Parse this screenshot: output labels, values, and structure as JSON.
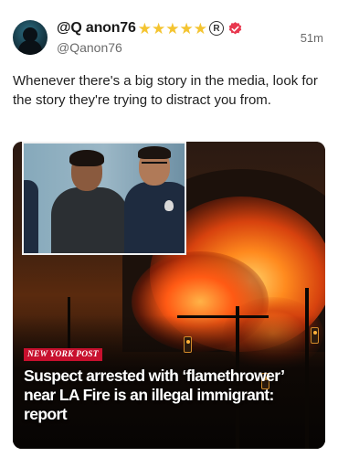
{
  "author": {
    "display_name": "@Q anon76",
    "handle": "@Qanon76",
    "stars": [
      "★",
      "★",
      "★",
      "★",
      "★"
    ],
    "registered_mark": "R",
    "avatar_icon": "avatar-silhouette-icon",
    "verified_icon": "verified-badge-icon",
    "accent_colors": {
      "star": "#f4c430",
      "verified": "#e8384f"
    }
  },
  "timestamp": "51m",
  "post": {
    "text": "Whenever there's a big story in the media, look for the story they're trying to distract you from."
  },
  "media": {
    "source_label": "NEW YORK POST",
    "headline": "Suspect arrested with ‘flamethrower’ near LA Fire is an illegal immigrant: report",
    "source_color": "#c8102e"
  }
}
